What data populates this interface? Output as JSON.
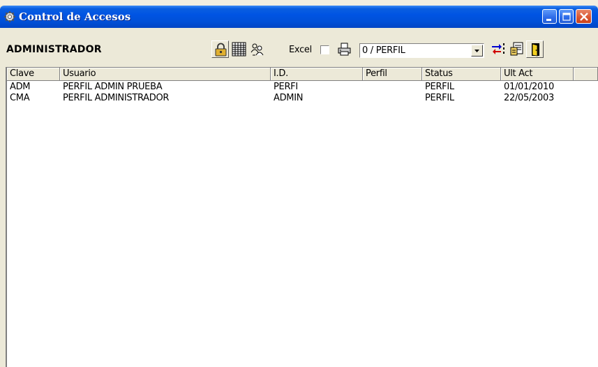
{
  "window": {
    "title": "Control de Accesos"
  },
  "toolbar": {
    "label": "ADMINISTRADOR",
    "excel_label": "Excel",
    "excel_checked": false,
    "profile_select_value": "0 / PERFIL",
    "icons": [
      "lock-icon",
      "grid-icon",
      "users-icon",
      "printer-icon",
      "transfer-icon",
      "document-icon",
      "exit-door-icon"
    ]
  },
  "table": {
    "columns": [
      "Clave",
      "Usuario",
      "I.D.",
      "Perfil",
      "Status",
      "Ult Act"
    ],
    "rows": [
      {
        "clave": "ADM",
        "usuario": "PERFIL ADMIN PRUEBA",
        "id": "PERFI",
        "perfil": "",
        "status": "PERFIL",
        "ult_act": "01/01/2010"
      },
      {
        "clave": "CMA",
        "usuario": "PERFIL ADMINISTRADOR",
        "id": "ADMIN",
        "perfil": "",
        "status": "PERFIL",
        "ult_act": "22/05/2003"
      }
    ]
  },
  "colors": {
    "titlebar": "#0054e3",
    "face": "#ece9d8",
    "close": "#d9542f"
  }
}
